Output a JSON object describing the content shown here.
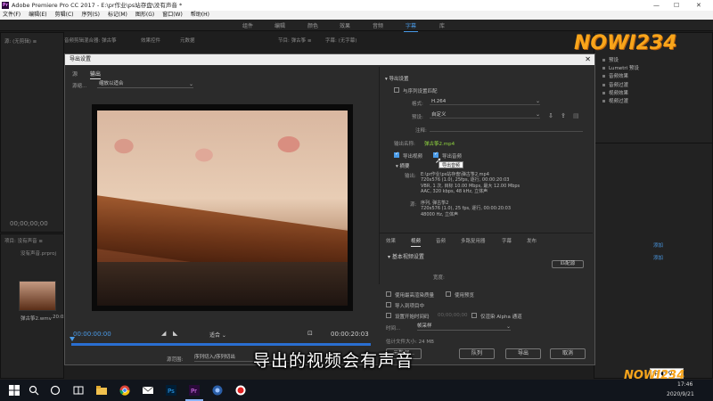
{
  "app": {
    "window_title": "Adobe Premiere Pro CC 2017 - E:\\pr作业\\ps站存盘\\没有声音 *",
    "menu": [
      "文件(F)",
      "编辑(E)",
      "剪辑(C)",
      "序列(S)",
      "标记(M)",
      "图形(G)",
      "窗口(W)",
      "帮助(H)"
    ],
    "workspaces": [
      "组件",
      "编辑",
      "颜色",
      "效果",
      "音频",
      "字幕",
      "库"
    ],
    "active_workspace": "字幕"
  },
  "background": {
    "left_tabs": [
      "源: (无剪辑) ≡",
      "音频剪辑混合器: 弹古筝"
    ],
    "mid_tabs": [
      "效果控件",
      "音频剪辑混合器: 弹古筝",
      "元数据"
    ],
    "right_top_tabs": [
      "节目: 弹古筝 ≡",
      "字幕: (无字幕)"
    ],
    "left_timecode": "00;00;00;00",
    "project_tabs": [
      "项目: 没有声音 ≡",
      "媒体浏览器"
    ],
    "project_file": "没有声音.prproj",
    "clip_name": "弹古筝2.wmv",
    "clip_duration": "20:03",
    "fx_items": [
      "预设",
      "Lumetri 预设",
      "音频效果",
      "音频过渡",
      "视频效果",
      "视频过渡"
    ],
    "right_links": [
      "添加",
      "添加"
    ]
  },
  "dialog": {
    "title": "导出设置",
    "source_tabs": [
      "源",
      "输出"
    ],
    "active_source_tab": "输出",
    "scaling_label": "源缩...",
    "scaling_value": "缩放以适合",
    "timecode_start": "00:00:00:00",
    "timecode_end": "00:00:20:03",
    "fit_value": "适合",
    "source_range_label": "源范围:",
    "source_range_value": "序列切入/序列切出",
    "export_settings": {
      "header": "导出设置",
      "match_sequence": "与序列设置匹配",
      "format_label": "格式:",
      "format_value": "H.264",
      "preset_label": "预设:",
      "preset_value": "自定义",
      "comment_label": "注释:",
      "output_name_label": "输出名称:",
      "output_name_value": "弹古筝2.mp4",
      "export_video": "导出视频",
      "export_audio": "导出音频",
      "export_video_checked": true,
      "export_audio_checked": true,
      "tooltip": "导出音频",
      "summary_label": "摘要",
      "output_label": "输出:",
      "output_lines": [
        "E:\\pr作业\\ps站存盘\\弹古筝2.mp4",
        "720x576 (1.0), 25fps, 逐行, 00:00:20:03",
        "VBR, 1 次, 目标 10.00 Mbps, 最大 12.00 Mbps",
        "AAC, 320 kbps, 48 kHz, 立体声"
      ],
      "source_label": "源:",
      "source_lines": [
        "序列, 弹古筝2",
        "720x576 (1.0), 25 fps, 逐行, 00:00:20:03",
        "48000 Hz, 立体声"
      ]
    },
    "lower_tabs": [
      "效果",
      "视频",
      "音频",
      "多路复用器",
      "字幕",
      "发布"
    ],
    "active_lower_tab": "视频",
    "basic_video_header": "基本视频设置",
    "match_source_button": "匹配源",
    "width_label": "宽度:",
    "options": [
      {
        "label": "使用最高渲染质量",
        "checked": false
      },
      {
        "label": "使用预览",
        "checked": false
      },
      {
        "label": "导入到项目中",
        "checked": false
      },
      {
        "label": "设置开始时间码",
        "checked": false
      },
      {
        "label": "仅渲染 Alpha 通道",
        "checked": false
      }
    ],
    "start_tc_placeholder": "00;00;00;00",
    "time_interp_label": "时间...",
    "time_interp_value": "帧采样",
    "file_size": "估计文件大小: 24 MB",
    "buttons": {
      "metadata": "元数据...",
      "queue": "队列",
      "export": "导出",
      "cancel": "取消"
    }
  },
  "overlay": {
    "subtitle": "导出的视频会有声音",
    "brand": "NOWI234",
    "brand_small": "NOWI234"
  },
  "taskbar": {
    "ime": "中 ◐ ♀",
    "time": "17:46",
    "date": "2020/9/21"
  },
  "colors": {
    "accent_blue": "#4a9be8",
    "link_green": "#8fd43f",
    "brand_orange": "#f8a51b"
  }
}
